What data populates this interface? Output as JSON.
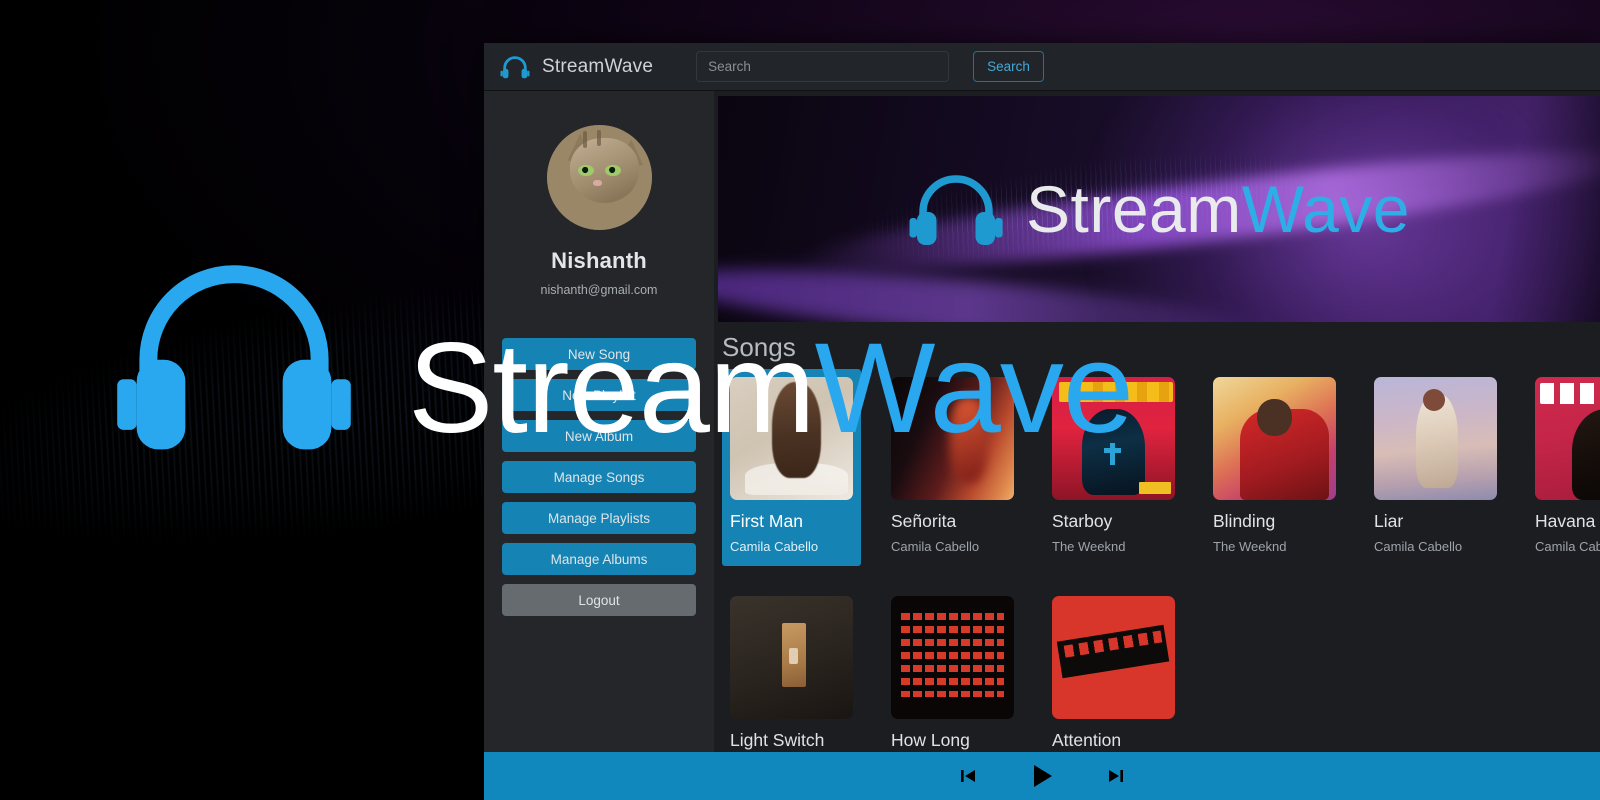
{
  "app": {
    "window_title": "StreamWave",
    "brand_icon": "headphones-icon"
  },
  "navbar": {
    "brand": "StreamWave",
    "search_placeholder": "Search",
    "search_value": "",
    "search_button": "Search"
  },
  "sidebar": {
    "avatar_alt": "cat-avatar",
    "user_name": "Nishanth",
    "user_email": "nishanth@gmail.com",
    "actions": [
      {
        "label": "New Song",
        "style": "primary"
      },
      {
        "label": "New Playlist",
        "style": "primary"
      },
      {
        "label": "New Album",
        "style": "primary"
      },
      {
        "label": "Manage Songs",
        "style": "primary"
      },
      {
        "label": "Manage Playlists",
        "style": "primary"
      },
      {
        "label": "Manage Albums",
        "style": "primary"
      },
      {
        "label": "Logout",
        "style": "secondary"
      }
    ]
  },
  "banner": {
    "word_1": "Stream",
    "word_2": "Wave",
    "icon": "headphones-icon"
  },
  "main": {
    "section_title": "Songs",
    "songs_row1": [
      {
        "title": "First Man",
        "artist": "Camila Cabello",
        "art": "cv-firstman",
        "selected": true
      },
      {
        "title": "Señorita",
        "artist": "Camila Cabello",
        "art": "cv-senorita",
        "selected": false
      },
      {
        "title": "Starboy",
        "artist": "The Weeknd",
        "art": "cv-starboy",
        "selected": false
      },
      {
        "title": "Blinding",
        "artist": "The Weeknd",
        "art": "cv-blinding",
        "selected": false
      },
      {
        "title": "Liar",
        "artist": "Camila Cabello",
        "art": "cv-liar",
        "selected": false
      },
      {
        "title": "Havana",
        "artist": "Camila Cabello",
        "art": "cv-havana",
        "selected": false
      }
    ],
    "songs_row2": [
      {
        "title": "Light Switch",
        "artist": "",
        "art": "cv-lightswitch",
        "selected": false
      },
      {
        "title": "How Long",
        "artist": "",
        "art": "cv-howlong",
        "selected": false
      },
      {
        "title": "Attention",
        "artist": "",
        "art": "cv-attention",
        "selected": false
      }
    ]
  },
  "player": {
    "previous_label": "previous-track",
    "play_label": "play",
    "next_label": "next-track"
  },
  "overlay": {
    "word_1": "Stream",
    "word_2": "Wave",
    "icon": "headphones-icon"
  },
  "colors": {
    "accent": "#1583b4",
    "accent_light": "#29a8f0",
    "player_bar": "#1087bd",
    "window_bg": "#1b1d21",
    "sidebar_bg": "#242629",
    "navbar_bg": "#212429",
    "logout_bg": "#666b70"
  }
}
